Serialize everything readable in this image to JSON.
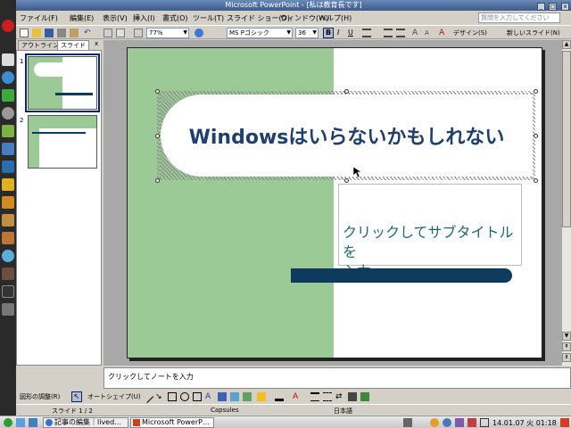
{
  "window": {
    "title": "Microsoft PowerPoint - [私は教育長です]",
    "min": "_",
    "max": "□",
    "close": "x"
  },
  "menu": {
    "items": [
      "ファイル(F)",
      "編集(E)",
      "表示(V)",
      "挿入(I)",
      "書式(O)",
      "ツール(T)",
      "スライド ショー(D)",
      "ウィンドウ(W)",
      "ヘルプ(H)"
    ],
    "help_placeholder": "質問を入力してください"
  },
  "toolbar": {
    "zoom": "77%",
    "font": "MS Pゴシック",
    "size": "36",
    "bold": "B",
    "italic": "I",
    "underline": "U",
    "design": "デザイン(S)",
    "new_slide": "新しいスライド(N)"
  },
  "pane": {
    "tab_outline": "アウトライン",
    "tab_slides": "スライド",
    "close": "x",
    "slide_numbers": [
      "1",
      "2"
    ]
  },
  "slide": {
    "title": "Windowsはいらないかもしれない",
    "subtitle_line1": "クリックしてサブタイトルを",
    "subtitle_line2": "入力"
  },
  "notes": {
    "placeholder": "クリックしてノートを入力"
  },
  "drawing": {
    "adjust": "図形の調整(R)",
    "autoshape": "オートシェイプ(U)"
  },
  "status": {
    "slide": "スライド 1 / 2",
    "template": "Capsules",
    "language": "日本語"
  },
  "taskbar": {
    "task1": "記事の編集｜lived…",
    "task2": "Microsoft PowerP…",
    "clock": "14.01.07 火 01:18"
  },
  "colors": {
    "green": "#9bca97",
    "title": "#1f3f6e",
    "bar": "#0e3a5e",
    "subtitle": "#1c6b6b"
  }
}
